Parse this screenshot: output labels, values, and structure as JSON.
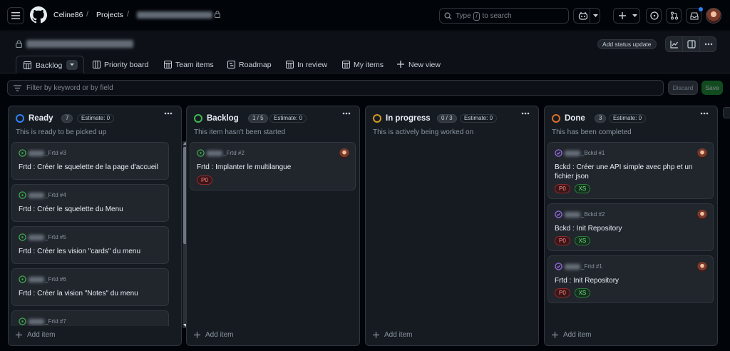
{
  "header": {
    "owner": "Celine86",
    "section": "Projects",
    "search_prefix": "Type",
    "search_key": "/",
    "search_suffix": "to search"
  },
  "project": {
    "status_button": "Add status update"
  },
  "tabs": [
    {
      "label": "Backlog",
      "icon": "table-icon"
    },
    {
      "label": "Priority board",
      "icon": "board-icon"
    },
    {
      "label": "Team items",
      "icon": "table-icon"
    },
    {
      "label": "Roadmap",
      "icon": "roadmap-icon"
    },
    {
      "label": "In review",
      "icon": "table-icon"
    },
    {
      "label": "My items",
      "icon": "table-icon"
    },
    {
      "label": "New view",
      "icon": "plus-icon"
    }
  ],
  "filter": {
    "placeholder": "Filter by keyword or by field",
    "discard": "Discard",
    "save": "Save"
  },
  "columns": [
    {
      "title": "Ready",
      "count": "7",
      "estimate": "Estimate: 0",
      "description": "This is ready to be picked up",
      "add_label": "Add item",
      "color": "#2f81f7",
      "cards": [
        {
          "ref": "_Frtd #3",
          "title": "Frtd : Créer le squelette de la page d'accueil"
        },
        {
          "ref": "_Frtd #4",
          "title": "Frtd : Créer le squelette du Menu"
        },
        {
          "ref": "_Frtd #5",
          "title": "Frtd : Créer les vision \"cards\" du menu"
        },
        {
          "ref": "_Frtd #6",
          "title": "Frtd : Créer la vision \"Notes\" du menu"
        },
        {
          "ref": "_Frtd #7",
          "title": ""
        }
      ]
    },
    {
      "title": "Backlog",
      "count": "1 / 5",
      "estimate": "Estimate: 0",
      "description": "This item hasn't been started",
      "add_label": "Add item",
      "color": "#3fb950",
      "cards": [
        {
          "ref": "_Frtd #2",
          "title": "Frtd : Implanter le multilangue",
          "labels": [
            "P0"
          ]
        }
      ]
    },
    {
      "title": "In progress",
      "count": "0 / 3",
      "estimate": "Estimate: 0",
      "description": "This is actively being worked on",
      "add_label": "Add item",
      "color": "#d29922",
      "cards": []
    },
    {
      "title": "Done",
      "count": "3",
      "estimate": "Estimate: 0",
      "description": "This has been completed",
      "add_label": "Add item",
      "color": "#db6d28",
      "cards": [
        {
          "ref": "_Bckd #1",
          "title": "Bckd : Créer une API simple avec php et un fichier json",
          "labels": [
            "P0",
            "XS"
          ]
        },
        {
          "ref": "_Bckd #2",
          "title": "Bckd : Init Repository",
          "labels": [
            "P0",
            "XS"
          ]
        },
        {
          "ref": "_Frtd #1",
          "title": "Frtd : Init Repository",
          "labels": [
            "P0",
            "XS"
          ]
        }
      ]
    }
  ]
}
